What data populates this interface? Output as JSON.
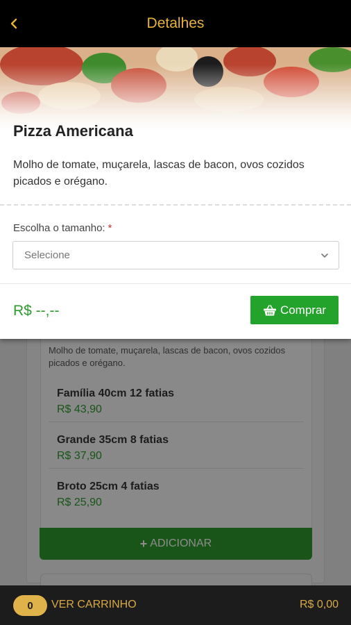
{
  "header": {
    "title": "Detalhes"
  },
  "product": {
    "name": "Pizza Americana",
    "description": "Molho de tomate, muçarela, lascas de bacon, ovos cozidos picados e orégano."
  },
  "size": {
    "label": "Escolha o tamanho:",
    "required_mark": "*",
    "placeholder": "Selecione"
  },
  "footer": {
    "price": "R$ --,--",
    "buy_label": "Comprar"
  },
  "background_page": {
    "description": "Molho de tomate, muçarela, lascas de bacon, ovos cozidos picados e orégano.",
    "options": [
      {
        "name": "Família 40cm 12 fatias",
        "price": "R$ 43,90"
      },
      {
        "name": "Grande 35cm 8 fatias",
        "price": "R$ 37,90"
      },
      {
        "name": "Broto 25cm 4 fatias",
        "price": "R$ 25,90"
      }
    ],
    "add_label": "ADICIONAR"
  },
  "cart": {
    "count": "0",
    "label": "VER CARRINHO",
    "total": "R$ 0,00"
  },
  "colors": {
    "accent_gold": "#e8b23a",
    "green": "#24a32c",
    "price_green": "#2e9b2e",
    "required_red": "#d9302c"
  }
}
